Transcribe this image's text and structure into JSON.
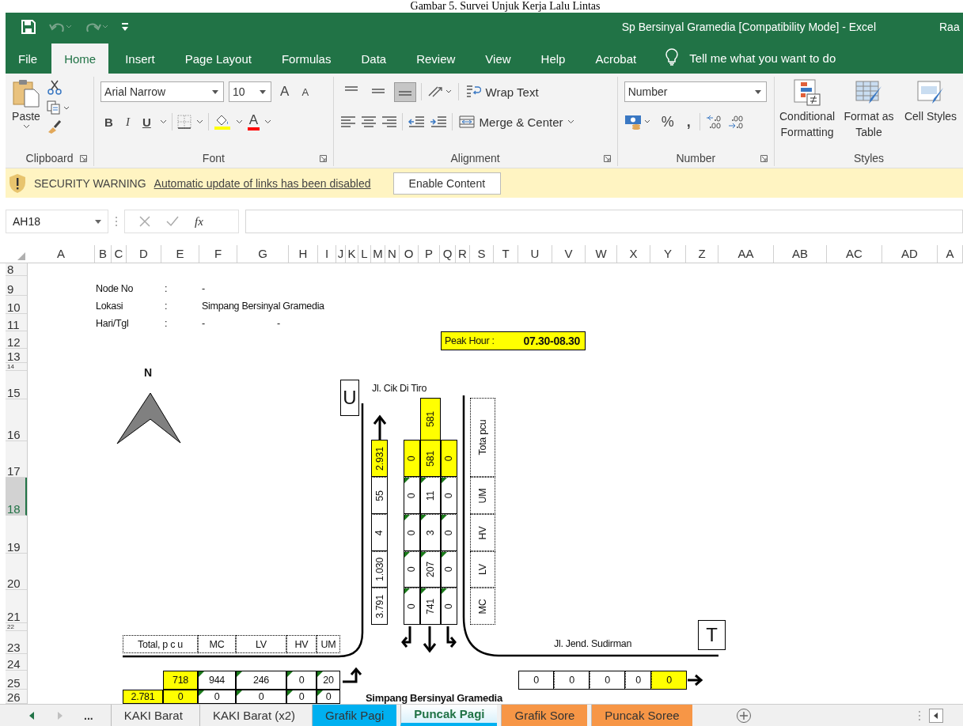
{
  "caption": "Gambar 5. Survei Unjuk Kerja Lalu Lintas",
  "title_bar": {
    "title": "Sp Bersinyal Gramedia  [Compatibility Mode]  -  Excel",
    "user": "Raa"
  },
  "ribbon_tabs": [
    {
      "label": "File",
      "selected": false
    },
    {
      "label": "Home",
      "selected": true
    },
    {
      "label": "Insert",
      "selected": false
    },
    {
      "label": "Page Layout",
      "selected": false
    },
    {
      "label": "Formulas",
      "selected": false
    },
    {
      "label": "Data",
      "selected": false
    },
    {
      "label": "Review",
      "selected": false
    },
    {
      "label": "View",
      "selected": false
    },
    {
      "label": "Help",
      "selected": false
    },
    {
      "label": "Acrobat",
      "selected": false
    }
  ],
  "tell_me": "Tell me what you want to do",
  "ribbon": {
    "clipboard": {
      "paste": "Paste",
      "group": "Clipboard"
    },
    "font": {
      "font_name": "Arial Narrow",
      "font_size": "10",
      "grow": "A",
      "shrink": "A",
      "bold": "B",
      "italic": "I",
      "underline": "U",
      "font_color": "A",
      "group": "Font"
    },
    "alignment": {
      "vertical": [
        {
          "selected": false
        },
        {
          "selected": false
        },
        {
          "selected": true
        }
      ],
      "wrap": "Wrap Text",
      "merge": "Merge & Center",
      "group": "Alignment"
    },
    "number": {
      "format": "Number",
      "percent": "%",
      "comma": ",",
      "group": "Number"
    },
    "styles": {
      "buttons": [
        {
          "label": "Conditional Formatting",
          "kind": "conditional"
        },
        {
          "label": "Format as Table",
          "kind": "table"
        },
        {
          "label": "Cell Styles",
          "kind": "cell"
        }
      ],
      "group": "Styles"
    }
  },
  "security": {
    "title": "SECURITY WARNING",
    "message": "Automatic update of links has been disabled",
    "button": "Enable Content"
  },
  "formula_bar": {
    "name_box": "AH18",
    "function_label": "fx"
  },
  "columns": [
    "A",
    "B",
    "C",
    "D",
    "E",
    "F",
    "G",
    "H",
    "I",
    "J",
    "K",
    "L",
    "M",
    "N",
    "O",
    "P",
    "Q",
    "R",
    "S",
    "T",
    "U",
    "V",
    "W",
    "X",
    "Y",
    "Z",
    "AA",
    "AB",
    "AC",
    "AD",
    "A"
  ],
  "rows": [
    {
      "label": "8",
      "selected": false
    },
    {
      "label": "9",
      "selected": false
    },
    {
      "label": "10",
      "selected": false
    },
    {
      "label": "11",
      "selected": false
    },
    {
      "label": "12",
      "selected": false
    },
    {
      "label": "13",
      "selected": false
    },
    {
      "label": "14",
      "selected": false
    },
    {
      "label": "15",
      "selected": false
    },
    {
      "label": "16",
      "selected": false
    },
    {
      "label": "17",
      "selected": false
    },
    {
      "label": "18",
      "selected": true
    },
    {
      "label": "19",
      "selected": false
    },
    {
      "label": "20",
      "selected": false
    },
    {
      "label": "21",
      "selected": false
    },
    {
      "label": "22",
      "selected": false
    },
    {
      "label": "23",
      "selected": false
    },
    {
      "label": "24",
      "selected": false
    },
    {
      "label": "25",
      "selected": false
    },
    {
      "label": "26",
      "selected": false
    }
  ],
  "sheet": {
    "info": [
      {
        "label": "Node No",
        "separator": ":",
        "value": "-"
      },
      {
        "label": "Lokasi",
        "separator": ":",
        "value": "Simpang Bersinyal Gramedia"
      },
      {
        "label": "Hari/Tgl",
        "separator": ":",
        "value": "-",
        "extra": "-"
      }
    ],
    "peak_hour": {
      "label": "Peak Hour  :",
      "value": "07.30-08.30"
    },
    "north_mark": "N",
    "north_leg": {
      "code": "U",
      "street": "Jl. Cik Di Tiro",
      "total": {
        "value": "581",
        "highlighted": true
      },
      "exit": [
        {
          "value": "2.931",
          "highlighted": true,
          "flagged": false
        },
        {
          "value": "55",
          "highlighted": false,
          "flagged": false
        },
        {
          "value": "4",
          "highlighted": false,
          "flagged": false
        },
        {
          "value": "1.030",
          "highlighted": false,
          "flagged": false
        },
        {
          "value": "3.791",
          "highlighted": false,
          "flagged": false
        }
      ],
      "lanes": [
        {
          "cells": [
            {
              "value": "0",
              "highlighted": true,
              "flagged": false
            },
            {
              "value": "0",
              "highlighted": false,
              "flagged": true
            },
            {
              "value": "0",
              "highlighted": false,
              "flagged": true
            },
            {
              "value": "0",
              "highlighted": false,
              "flagged": true
            },
            {
              "value": "0",
              "highlighted": false,
              "flagged": true
            }
          ]
        },
        {
          "cells": [
            {
              "value": "581",
              "highlighted": true,
              "flagged": false
            },
            {
              "value": "11",
              "highlighted": false,
              "flagged": true
            },
            {
              "value": "3",
              "highlighted": false,
              "flagged": true
            },
            {
              "value": "207",
              "highlighted": false,
              "flagged": true
            },
            {
              "value": "741",
              "highlighted": false,
              "flagged": true
            }
          ]
        },
        {
          "cells": [
            {
              "value": "0",
              "highlighted": true,
              "flagged": false
            },
            {
              "value": "0",
              "highlighted": false,
              "flagged": true
            },
            {
              "value": "0",
              "highlighted": false,
              "flagged": true
            },
            {
              "value": "0",
              "highlighted": false,
              "flagged": true
            },
            {
              "value": "0",
              "highlighted": false,
              "flagged": true
            }
          ]
        }
      ],
      "types": [
        "Tota pcu",
        "UM",
        "HV",
        "LV",
        "MC"
      ]
    },
    "east_leg": {
      "code": "T",
      "street": "Jl. Jend. Sudirman",
      "cells": [
        {
          "value": "0",
          "highlighted": false
        },
        {
          "value": "0",
          "highlighted": false
        },
        {
          "value": "0",
          "highlighted": false
        },
        {
          "value": "0",
          "highlighted": false
        },
        {
          "value": "0",
          "highlighted": true
        }
      ]
    },
    "west_leg": {
      "headers": [
        "Total, p c u",
        "MC",
        "LV",
        "HV",
        "UM"
      ],
      "rows": [
        {
          "cells": [
            null,
            {
              "value": "718",
              "highlighted": true,
              "flagged": false
            },
            {
              "value": "944",
              "highlighted": false,
              "flagged": true
            },
            {
              "value": "246",
              "highlighted": false,
              "flagged": true
            },
            {
              "value": "0",
              "highlighted": false,
              "flagged": true
            },
            {
              "value": "20",
              "highlighted": false,
              "flagged": true
            }
          ]
        },
        {
          "cells": [
            {
              "value": "2.781",
              "highlighted": true,
              "flagged": false
            },
            {
              "value": "0",
              "highlighted": true,
              "flagged": false
            },
            {
              "value": "0",
              "highlighted": false,
              "flagged": true
            },
            {
              "value": "0",
              "highlighted": false,
              "flagged": true
            },
            {
              "value": "0",
              "highlighted": false,
              "flagged": true
            },
            {
              "value": "0",
              "highlighted": false,
              "flagged": true
            }
          ]
        }
      ],
      "street": "Simpang Bersinyal Gramedia"
    }
  },
  "sheet_tabs": {
    "more": "...",
    "tabs": [
      {
        "label": "KAKI Barat",
        "selected": false
      },
      {
        "label": "KAKI Barat (x2)",
        "selected": false
      },
      {
        "label": "Grafik Pagi",
        "selected": false,
        "color": "#00b0f0"
      },
      {
        "label": "Puncak Pagi",
        "selected": true,
        "color": "#00b0f0"
      },
      {
        "label": "Grafik Sore",
        "selected": false,
        "color": "#f79646"
      },
      {
        "label": "Puncak Soree",
        "selected": false,
        "color": "#f79646"
      }
    ]
  }
}
